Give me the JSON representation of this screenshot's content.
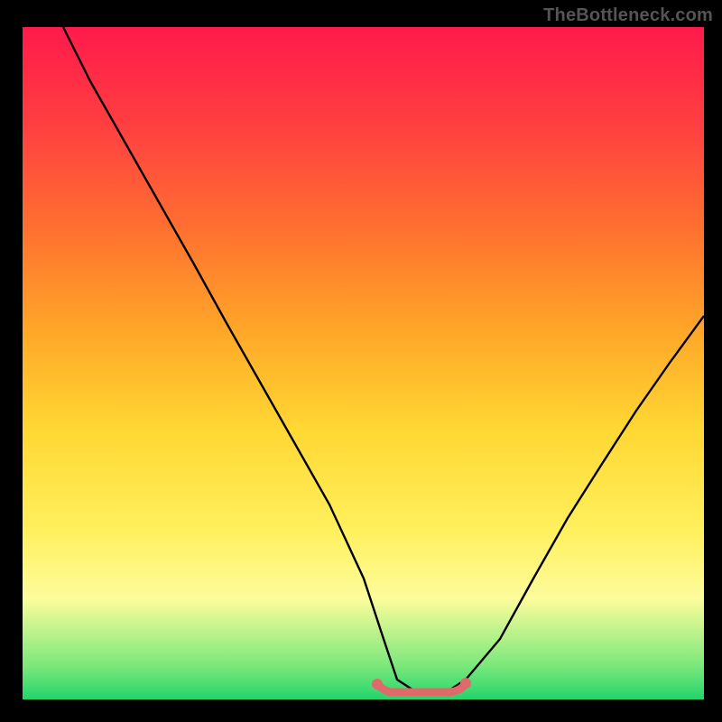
{
  "watermark": "TheBottleneck.com",
  "chart_data": {
    "type": "line",
    "title": "",
    "xlabel": "",
    "ylabel": "",
    "xlim": [
      0,
      100
    ],
    "ylim": [
      0,
      100
    ],
    "background": {
      "gradient_stops": [
        {
          "pos": 0,
          "color": "#ff1a4b"
        },
        {
          "pos": 15,
          "color": "#ff4040"
        },
        {
          "pos": 30,
          "color": "#ff7030"
        },
        {
          "pos": 45,
          "color": "#ffa628"
        },
        {
          "pos": 60,
          "color": "#ffd833"
        },
        {
          "pos": 75,
          "color": "#fff05e"
        },
        {
          "pos": 85,
          "color": "#fdfc9c"
        },
        {
          "pos": 95,
          "color": "#7be87b"
        },
        {
          "pos": 100,
          "color": "#22d56b"
        }
      ]
    },
    "series": [
      {
        "name": "bottleneck-curve",
        "color": "#000000",
        "x": [
          6,
          10,
          15,
          20,
          25,
          30,
          35,
          40,
          45,
          50,
          53,
          55,
          58,
          60,
          62,
          65,
          70,
          75,
          80,
          85,
          90,
          95,
          100
        ],
        "y": [
          100,
          92,
          83,
          74,
          65,
          56,
          47,
          38,
          29,
          18,
          9,
          3,
          1,
          1,
          1,
          3,
          9,
          18,
          27,
          35,
          43,
          50,
          57
        ]
      },
      {
        "name": "optimal-range-marker",
        "color": "#e06a6a",
        "x": [
          52,
          54,
          56,
          58,
          60,
          62,
          64,
          65
        ],
        "y": [
          2.3,
          1.4,
          1.0,
          1.0,
          1.0,
          1.0,
          1.6,
          2.4
        ]
      }
    ],
    "optimal_range": {
      "start": 52,
      "end": 65
    }
  }
}
